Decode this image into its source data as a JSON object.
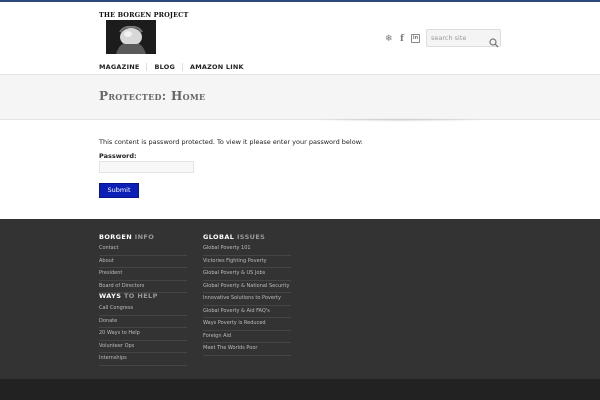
{
  "header": {
    "logo_text": "THE BORGEN PROJECT",
    "social": [
      {
        "name": "twitter",
        "glyph": "❄"
      },
      {
        "name": "facebook",
        "glyph": "f"
      },
      {
        "name": "linkedin",
        "glyph": "in"
      }
    ],
    "search": {
      "placeholder": "search site",
      "icon": "search-icon"
    }
  },
  "nav": {
    "items": [
      "MAGAZINE",
      "BLOG",
      "AMAZON LINK"
    ]
  },
  "page": {
    "title": "Protected: Home"
  },
  "content": {
    "message": "This content is password protected. To view it please enter your password below:",
    "password_label": "Password:",
    "submit_label": "Submit"
  },
  "footer": {
    "borgen_info": {
      "heading_bold": "BORGEN",
      "heading_rest": " INFO",
      "links": [
        "Contact",
        "About",
        "President",
        "Board of Directors"
      ]
    },
    "ways_to_help": {
      "heading_bold": "WAYS",
      "heading_rest": " TO HELP",
      "links": [
        "Call Congress",
        "Donate",
        "20 Ways to Help",
        "Volunteer Ops",
        "Internships"
      ]
    },
    "global_issues": {
      "heading_bold": "GLOBAL",
      "heading_rest": " ISSUES",
      "links": [
        "Global Poverty 101",
        "Victories Fighting Poverty",
        "Global Poverty & US Jobs",
        "Global Poverty & National Security",
        "Innovative Solutions to Poverty",
        "Global Poverty & Aid FAQ's",
        "Ways Poverty is Reduced",
        "Foreign Aid",
        "Meet The Worlds Poor"
      ]
    }
  },
  "colors": {
    "accent": "#0b1eb5",
    "topbar": "#2d4a7e",
    "footer": "#333333"
  }
}
